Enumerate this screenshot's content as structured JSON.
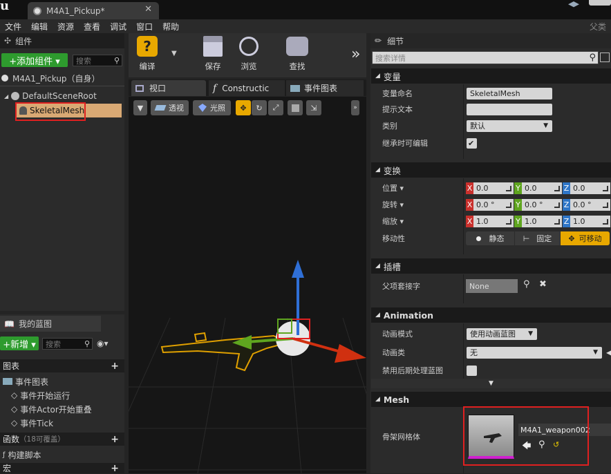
{
  "window": {
    "tab_title": "M4A1_Pickup*",
    "close_glyph": "✕"
  },
  "menu": {
    "items": [
      "文件",
      "编辑",
      "资源",
      "查看",
      "调试",
      "窗口",
      "帮助"
    ],
    "right_label": "父类"
  },
  "components_panel": {
    "title": "组件",
    "add_button": "+添加组件 ▾",
    "search_placeholder": "搜索",
    "self_item": "M4A1_Pickup（自身）",
    "tree": [
      {
        "label": "DefaultSceneRoot"
      },
      {
        "label": "SkeletalMesh",
        "selected": true
      }
    ]
  },
  "toolbar": {
    "compile": "编译",
    "save": "保存",
    "browse": "浏览",
    "find": "查找",
    "more": "»"
  },
  "editor_tabs": [
    {
      "label": "视口",
      "active": true
    },
    {
      "label": "Constructic"
    },
    {
      "label": "事件图表"
    }
  ],
  "viewport_toolbar": {
    "perspective": "透视",
    "lit": "光照"
  },
  "my_blueprint": {
    "title": "我的蓝图",
    "new_button": "+新增 ▾",
    "search_placeholder": "搜索",
    "graphs_header": "图表",
    "event_graph": "事件图表",
    "events": [
      "事件开始运行",
      "事件Actor开始重叠",
      "事件Tick"
    ],
    "functions_header": "函数",
    "functions_note": "（18可覆盖）",
    "construct_script": "构建脚本",
    "macros_header": "宏"
  },
  "details": {
    "title": "细节",
    "search_placeholder": "搜索详情",
    "variables": {
      "header": "变量",
      "name_label": "变量命名",
      "name_value": "SkeletalMesh",
      "tooltip_label": "提示文本",
      "tooltip_value": "",
      "category_label": "类别",
      "category_value": "默认",
      "editable_label": "继承时可编辑",
      "editable_checked": true
    },
    "transform": {
      "header": "变换",
      "location_label": "位置 ▾",
      "location": [
        "0.0",
        "0.0",
        "0.0"
      ],
      "rotation_label": "旋转 ▾",
      "rotation": [
        "0.0 °",
        "0.0 °",
        "0.0 °"
      ],
      "scale_label": "缩放 ▾",
      "scale": [
        "1.0",
        "1.0",
        "1.0"
      ],
      "mobility_label": "移动性",
      "mobility_options": [
        "静态",
        "固定",
        "可移动"
      ],
      "mobility_selected": "可移动"
    },
    "axes": [
      "X",
      "Y",
      "Z"
    ],
    "axis_colors": [
      "#c9302c",
      "#5fa51f",
      "#2f76c7"
    ],
    "sockets": {
      "header": "插槽",
      "parent_label": "父项套接字",
      "parent_value": "None"
    },
    "animation": {
      "header": "Animation",
      "mode_label": "动画模式",
      "mode_value": "使用动画蓝图",
      "class_label": "动画类",
      "class_value": "无",
      "disable_post_label": "禁用后期处理蓝图"
    },
    "mesh": {
      "header": "Mesh",
      "label": "骨架网格体",
      "asset": "M4A1_weapon002"
    }
  },
  "accent": "#e8a800"
}
